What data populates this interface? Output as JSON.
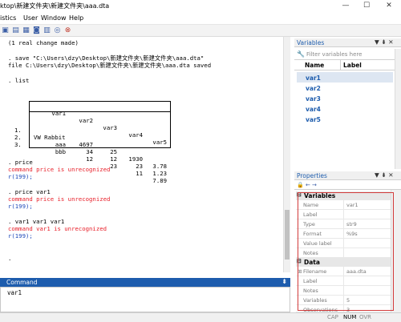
{
  "window": {
    "title": "ktop\\新建文件夹\\新建文件夹\\aaa.dta",
    "minimize_glyph": "—",
    "maximize_glyph": "☐",
    "close_glyph": "✕"
  },
  "menu": {
    "items": [
      "istics",
      "User",
      "Window",
      "Help"
    ]
  },
  "toolbar": {
    "icons": [
      "log-icon",
      "viewer-icon",
      "graph-icon",
      "do-file-editor-icon",
      "data-editor-icon",
      "break-icon",
      "stop-icon"
    ],
    "glyphs": [
      "▣",
      "▤",
      "▦",
      "◙",
      "▥",
      "◎",
      "⊗"
    ]
  },
  "results": {
    "lines": [
      {
        "text": "(1 real change made)",
        "style": "cmd"
      },
      {
        "text": ". save \"C:\\Users\\dzy\\Desktop\\新建文件夹\\新建文件夹\\aaa.dta\"",
        "style": "cmd"
      },
      {
        "text": "file C:\\Users\\dzy\\Desktop\\新建文件夹\\新建文件夹\\aaa.dta saved",
        "style": "cmd"
      },
      {
        "text": ". list",
        "style": "cmd"
      },
      {
        "text": ". price",
        "style": "cmd"
      },
      {
        "text": "command price is unrecognized",
        "style": "red"
      },
      {
        "text": "r(199);",
        "style": "blue"
      },
      {
        "text": ". price var1",
        "style": "cmd"
      },
      {
        "text": "command price is unrecognized",
        "style": "red"
      },
      {
        "text": "r(199);",
        "style": "blue"
      },
      {
        "text": ". var1 var1 var1",
        "style": "cmd"
      },
      {
        "text": "command var1 is unrecognized",
        "style": "red"
      },
      {
        "text": "r(199);",
        "style": "blue"
      },
      {
        "text": ".",
        "style": "cmd"
      }
    ],
    "list_table": {
      "headers": [
        "var1",
        "var2",
        "var3",
        "var4",
        "var5"
      ],
      "rows": [
        {
          "n": "1.",
          "cells": [
            "VW Rabbit",
            "4697",
            "25",
            "1930",
            "3.78"
          ]
        },
        {
          "n": "2.",
          "cells": [
            "aaa",
            "34",
            "12",
            "23",
            "1.23"
          ]
        },
        {
          "n": "3.",
          "cells": [
            "bbb",
            "12",
            "23",
            "11",
            "7.89"
          ]
        }
      ]
    }
  },
  "command": {
    "title": "Command",
    "pin": "⇟",
    "value": "var1"
  },
  "variables": {
    "title": "Variables",
    "controls": "▼ ⇟ ✕",
    "filter_placeholder": "Filter variables here",
    "filter_icon": "wrench-icon",
    "columns": [
      "Name",
      "Label"
    ],
    "items": [
      "var1",
      "var2",
      "var3",
      "var4",
      "var5"
    ],
    "selected_index": 0
  },
  "properties": {
    "title": "Properties",
    "controls": "▼ ⇟ ✕",
    "toolbar_glyphs": "🔒 ← →",
    "groups": [
      {
        "name": "Variables",
        "rows": [
          {
            "key": "Name",
            "value": "var1"
          },
          {
            "key": "Label",
            "value": ""
          },
          {
            "key": "Type",
            "value": "str9"
          },
          {
            "key": "Format",
            "value": "%9s"
          },
          {
            "key": "Value label",
            "value": ""
          },
          {
            "key": "Notes",
            "value": ""
          }
        ]
      },
      {
        "name": "Data",
        "rows": [
          {
            "key": "Filename",
            "value": "aaa.dta"
          },
          {
            "key": "Label",
            "value": ""
          },
          {
            "key": "Notes",
            "value": ""
          },
          {
            "key": "Variables",
            "value": "5"
          },
          {
            "key": "Observations",
            "value": "3"
          }
        ]
      }
    ]
  },
  "status": {
    "cap": "CAP",
    "num": "NUM",
    "ovr": "OVR"
  },
  "colors": {
    "accent": "#1d5cad",
    "error_red": "#e8202a",
    "rc_blue": "#1c47b8",
    "annotation_box": "#d23b3b"
  }
}
